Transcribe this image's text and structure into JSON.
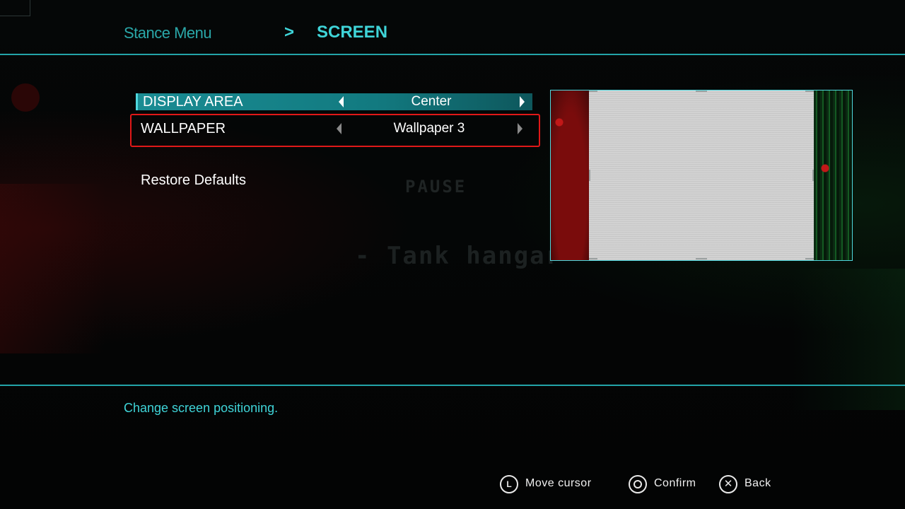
{
  "background": {
    "pause_text": "PAUSE",
    "location_text": "- Tank hangar -"
  },
  "header": {
    "breadcrumb_parent": "Stance Menu",
    "breadcrumb_separator": ">",
    "title": "SCREEN"
  },
  "options": [
    {
      "label": "DISPLAY AREA",
      "value": "Center",
      "selected": true
    },
    {
      "label": "WALLPAPER",
      "value": "Wallpaper 3",
      "selected": false
    }
  ],
  "restore_defaults_label": "Restore Defaults",
  "hint": "Change screen positioning.",
  "prompts": {
    "move": {
      "icon": "left-stick-icon",
      "glyph": "L",
      "label": "Move cursor"
    },
    "confirm": {
      "icon": "circle-button-icon",
      "label": "Confirm"
    },
    "back": {
      "icon": "cross-button-icon",
      "glyph": "✕",
      "label": "Back"
    }
  },
  "colors": {
    "accent": "#3fd4d8",
    "accent_dim": "#2aa7a8",
    "focus_frame": "#e01818",
    "selected_row": "#1a8c93"
  }
}
